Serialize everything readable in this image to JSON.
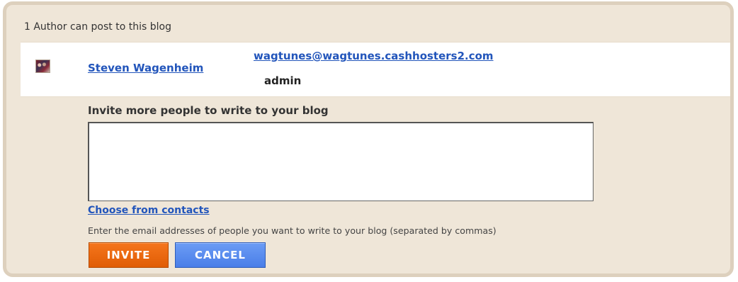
{
  "header": {
    "authors_text": "1 Author can post to this blog"
  },
  "authors": [
    {
      "name": "Steven Wagenheim",
      "email": "wagtunes@wagtunes.cashhosters2.com",
      "role": "admin"
    }
  ],
  "invite": {
    "label": "Invite more people to write to your blog",
    "textarea_value": "",
    "contacts_link": "Choose from contacts",
    "help_text": "Enter the email addresses of people you want to write to your blog (separated by commas)",
    "invite_button": "INVITE",
    "cancel_button": "CANCEL"
  },
  "colors": {
    "panel_background": "#efe6d8",
    "panel_border": "#ddd0bd",
    "link": "#2255bb",
    "invite_button": "#f26b10",
    "cancel_button": "#5b8ef0"
  }
}
